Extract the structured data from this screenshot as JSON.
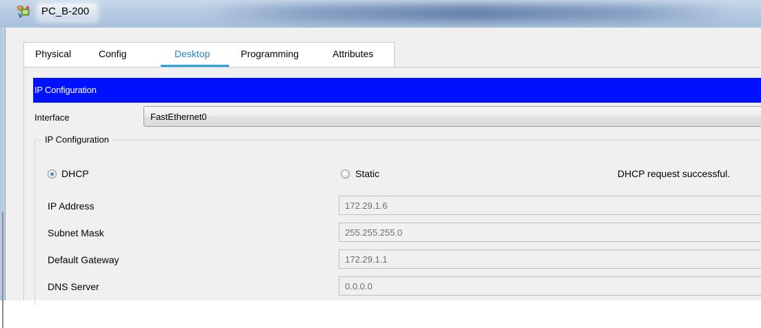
{
  "window": {
    "title": "PC_B-200",
    "icon": "pc-device-icon"
  },
  "tabs": [
    {
      "label": "Physical",
      "active": false
    },
    {
      "label": "Config",
      "active": false
    },
    {
      "label": "Desktop",
      "active": true
    },
    {
      "label": "Programming",
      "active": false
    },
    {
      "label": "Attributes",
      "active": false
    }
  ],
  "ip_config": {
    "header": "IP Configuration",
    "interface_label": "Interface",
    "interface_value": "FastEthernet0",
    "group_title": "IP Configuration",
    "mode_dhcp_label": "DHCP",
    "mode_static_label": "Static",
    "selected_mode": "DHCP",
    "status": "DHCP request successful.",
    "fields": [
      {
        "label": "IP Address",
        "value": "172.29.1.6"
      },
      {
        "label": "Subnet Mask",
        "value": "255.255.255.0"
      },
      {
        "label": "Default Gateway",
        "value": "172.29.1.1"
      },
      {
        "label": "DNS Server",
        "value": "0.0.0.0"
      }
    ]
  },
  "colors": {
    "header_bar": "#0011ff",
    "active_tab_text": "#1f86c7",
    "active_tab_underline": "#2aa1e0"
  }
}
